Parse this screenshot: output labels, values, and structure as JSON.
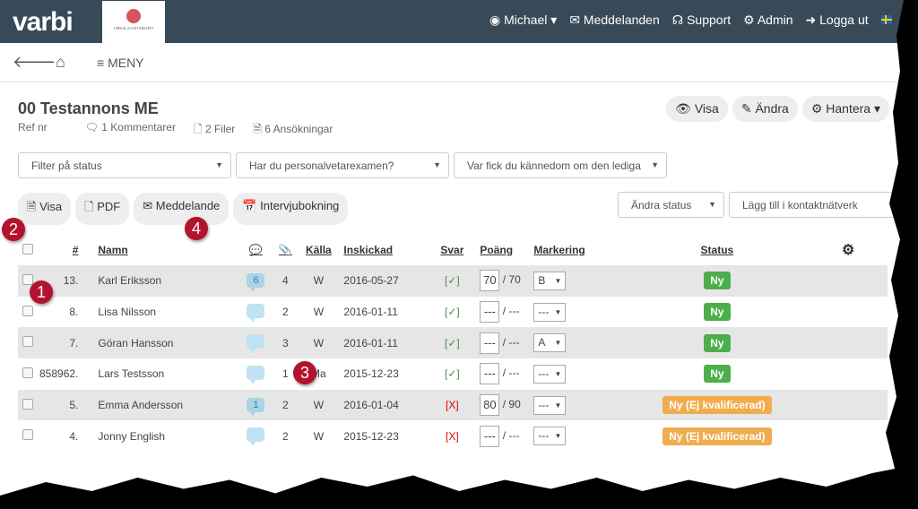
{
  "header": {
    "logo": "varbi",
    "university": "UPPSALA UNIVERSITET",
    "nav": [
      {
        "label": "Michael ▾",
        "icon": "user-icon"
      },
      {
        "label": "Meddelanden",
        "icon": "envelope-icon"
      },
      {
        "label": "Support",
        "icon": "headset-icon"
      },
      {
        "label": "Admin",
        "icon": "cogs-icon"
      },
      {
        "label": "Logga ut",
        "icon": "logout-icon"
      }
    ]
  },
  "navbar": {
    "menu": "MENY"
  },
  "page": {
    "title": "00 Testannons ME",
    "ref": "Ref nr",
    "comments": "1 Kommentarer",
    "files": "2 Filer",
    "applications": "6 Ansökningar",
    "view": "Visa",
    "edit": "Ändra",
    "manage": "Hantera ▾"
  },
  "filters": [
    "Filter på status",
    "Har du personalvetarexamen?",
    "Var fick du kännedom om den lediga"
  ],
  "actions": {
    "view": "Visa",
    "pdf": "PDF",
    "message": "Meddelande",
    "interview": "Intervjubokning",
    "change_status": "Ändra status",
    "add_network": "Lägg till i kontaktnätverk"
  },
  "table": {
    "headers": {
      "num": "#",
      "name": "Namn",
      "source": "Källa",
      "submitted": "Inskickad",
      "answer": "Svar",
      "points": "Poäng",
      "marking": "Markering",
      "status": "Status"
    },
    "rows": [
      {
        "num": "13.",
        "name": "Karl Eriksson",
        "comments": "6",
        "files": "4",
        "source": "W",
        "date": "2016-05-27",
        "answer": "[✓]",
        "answer_ok": true,
        "score": "70",
        "max": "/ 70",
        "mark": "B",
        "status": "Ny",
        "status_color": "#4cae4c"
      },
      {
        "num": "8.",
        "name": "Lisa Nilsson",
        "comments": "",
        "files": "2",
        "source": "W",
        "date": "2016-01-11",
        "answer": "[✓]",
        "answer_ok": true,
        "score": "---",
        "max": "/ ---",
        "mark": "---",
        "status": "Ny",
        "status_color": "#4cae4c"
      },
      {
        "num": "7.",
        "name": "Göran Hansson",
        "comments": "",
        "files": "3",
        "source": "W",
        "date": "2016-01-11",
        "answer": "[✓]",
        "answer_ok": true,
        "score": "---",
        "max": "/ ---",
        "mark": "A",
        "status": "Ny",
        "status_color": "#4cae4c"
      },
      {
        "num": "858962.",
        "name": "Lars Testsson",
        "comments": "",
        "files": "1",
        "source": "Ma",
        "date": "2015-12-23",
        "answer": "[✓]",
        "answer_ok": true,
        "score": "---",
        "max": "/ ---",
        "mark": "---",
        "status": "Ny",
        "status_color": "#4cae4c"
      },
      {
        "num": "5.",
        "name": "Emma Andersson",
        "comments": "1",
        "files": "2",
        "source": "W",
        "date": "2016-01-04",
        "answer": "[X]",
        "answer_ok": false,
        "score": "80",
        "max": "/ 90",
        "mark": "---",
        "status": "Ny (Ej kvalificerad)",
        "status_color": "#f0ad4e"
      },
      {
        "num": "4.",
        "name": "Jonny English",
        "comments": "",
        "files": "2",
        "source": "W",
        "date": "2015-12-23",
        "answer": "[X]",
        "answer_ok": false,
        "score": "---",
        "max": "/ ---",
        "mark": "---",
        "status": "Ny (Ej kvalificerad)",
        "status_color": "#f0ad4e"
      }
    ]
  },
  "callouts": [
    "1",
    "2",
    "3",
    "4"
  ]
}
